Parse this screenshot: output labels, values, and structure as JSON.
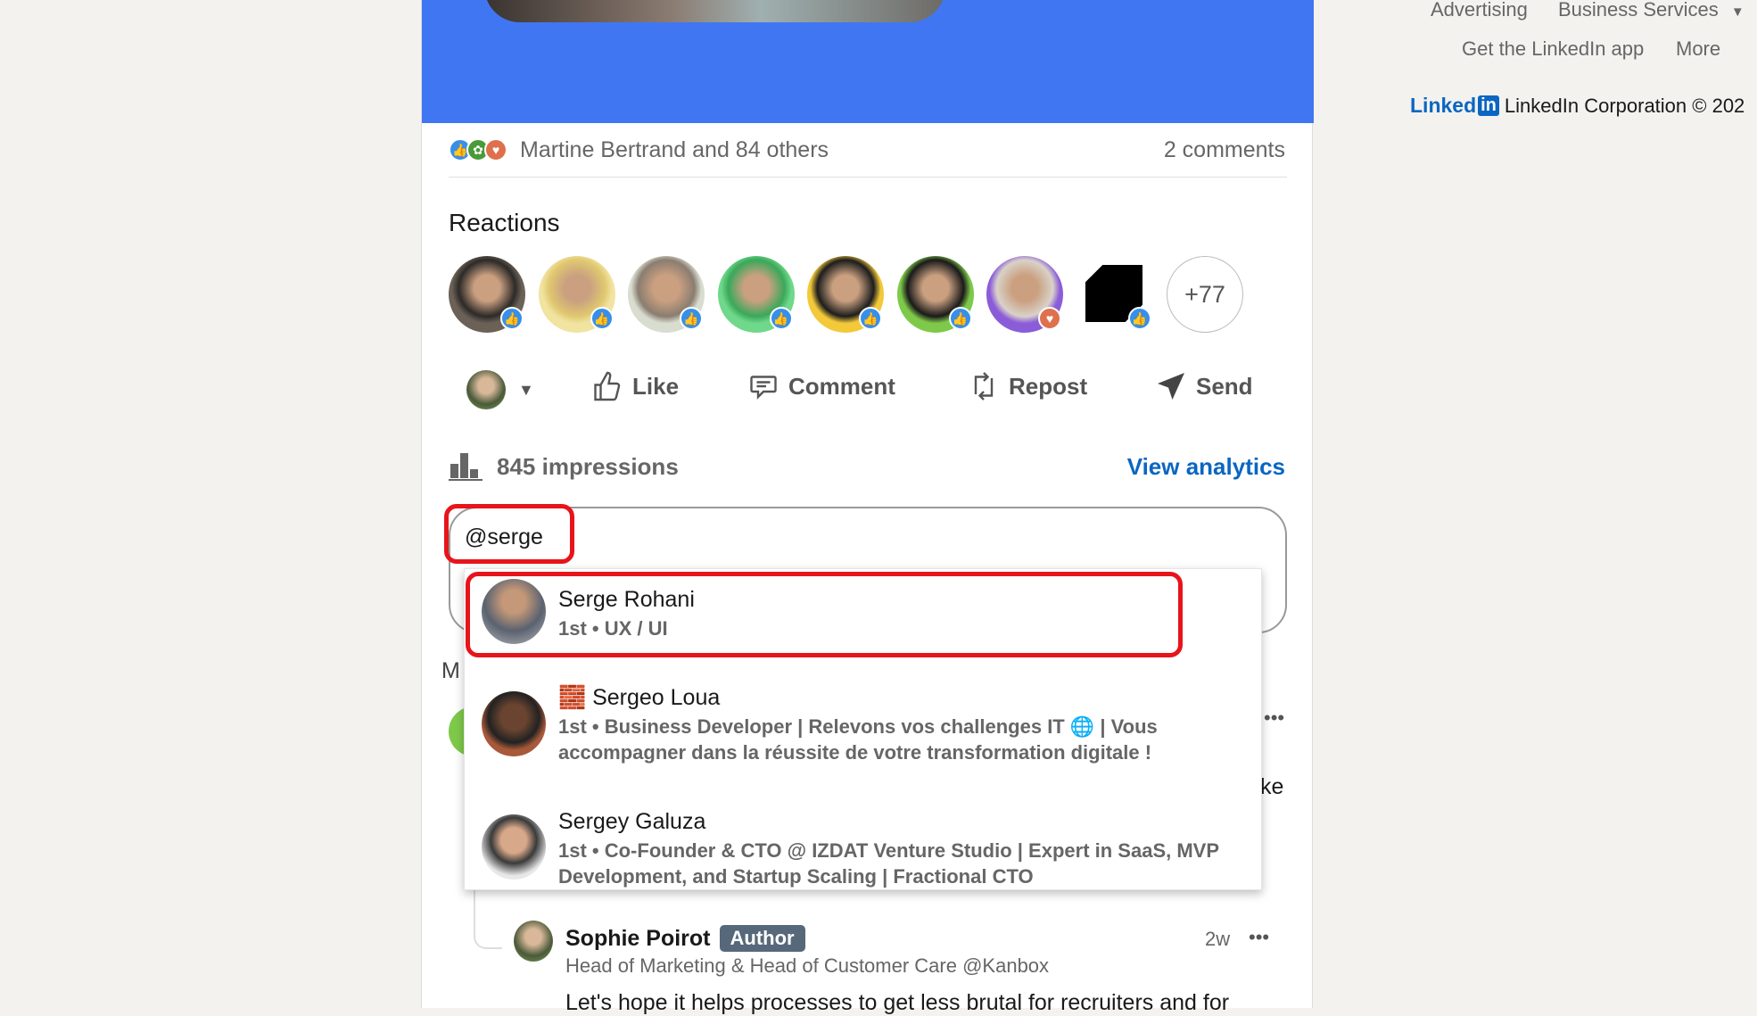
{
  "post": {
    "reactions_summary": "Martine Bertrand and 84 others",
    "comments_count": "2 comments",
    "reactions_heading": "Reactions",
    "reactors": [
      {
        "reaction": "like",
        "colors": [
          "#6b6157",
          "#2d2a28"
        ]
      },
      {
        "reaction": "like",
        "colors": [
          "#f1e3a0",
          "#e0c870"
        ]
      },
      {
        "reaction": "like",
        "colors": [
          "#d8ddd0",
          "#8a7d70"
        ]
      },
      {
        "reaction": "like",
        "colors": [
          "#6fd88a",
          "#3aa85a"
        ]
      },
      {
        "reaction": "like",
        "colors": [
          "#f3c93a",
          "#1d1d1d"
        ]
      },
      {
        "reaction": "like",
        "colors": [
          "#7ec94a",
          "#1a1a1a"
        ]
      },
      {
        "reaction": "love",
        "colors": [
          "#8b5cd8",
          "#d9d2c9"
        ]
      },
      {
        "reaction": "like",
        "colors": [
          "#000000",
          "#ffffff"
        ]
      }
    ],
    "more_reactors": "+77",
    "actions": {
      "like": "Like",
      "comment": "Comment",
      "repost": "Repost",
      "send": "Send"
    },
    "impressions": "845 impressions",
    "view_analytics": "View analytics"
  },
  "comment_input": {
    "value": "@serge"
  },
  "mentions": [
    {
      "name": "Serge Rohani",
      "emoji": "",
      "line1": "1st • UX / UI",
      "line2": ""
    },
    {
      "name": "Sergeo Loua",
      "emoji": "🧱",
      "line1": "1st • Business Developer | Relevons vos challenges IT 🌐 | Vous",
      "line2": "accompagner dans la réussite de votre transformation digitale !"
    },
    {
      "name": "Sergey Galuza",
      "emoji": "",
      "line1": "1st • Co-Founder & CTO @ IZDAT Venture Studio | Expert in SaaS, MVP",
      "line2": "Development, and Startup Scaling | Fractional CTO"
    }
  ],
  "behind": {
    "sort_label_partial": "M",
    "text_partial": "ke"
  },
  "reply": {
    "name": "Sophie Poirot",
    "badge": "Author",
    "time": "2w",
    "headline": "Head of Marketing & Head of Customer Care @Kanbox",
    "text": "Let's hope it helps processes to get less brutal for recruiters and for"
  },
  "footer": {
    "links": [
      "Advertising",
      "Business Services",
      "Get the LinkedIn app",
      "More"
    ],
    "logo_text": "Linked",
    "logo_in": "in",
    "copyright": "LinkedIn Corporation © 202"
  },
  "colors": {
    "banner": "#4176f2",
    "link": "#0a66c2",
    "highlight": "#e8141b"
  }
}
